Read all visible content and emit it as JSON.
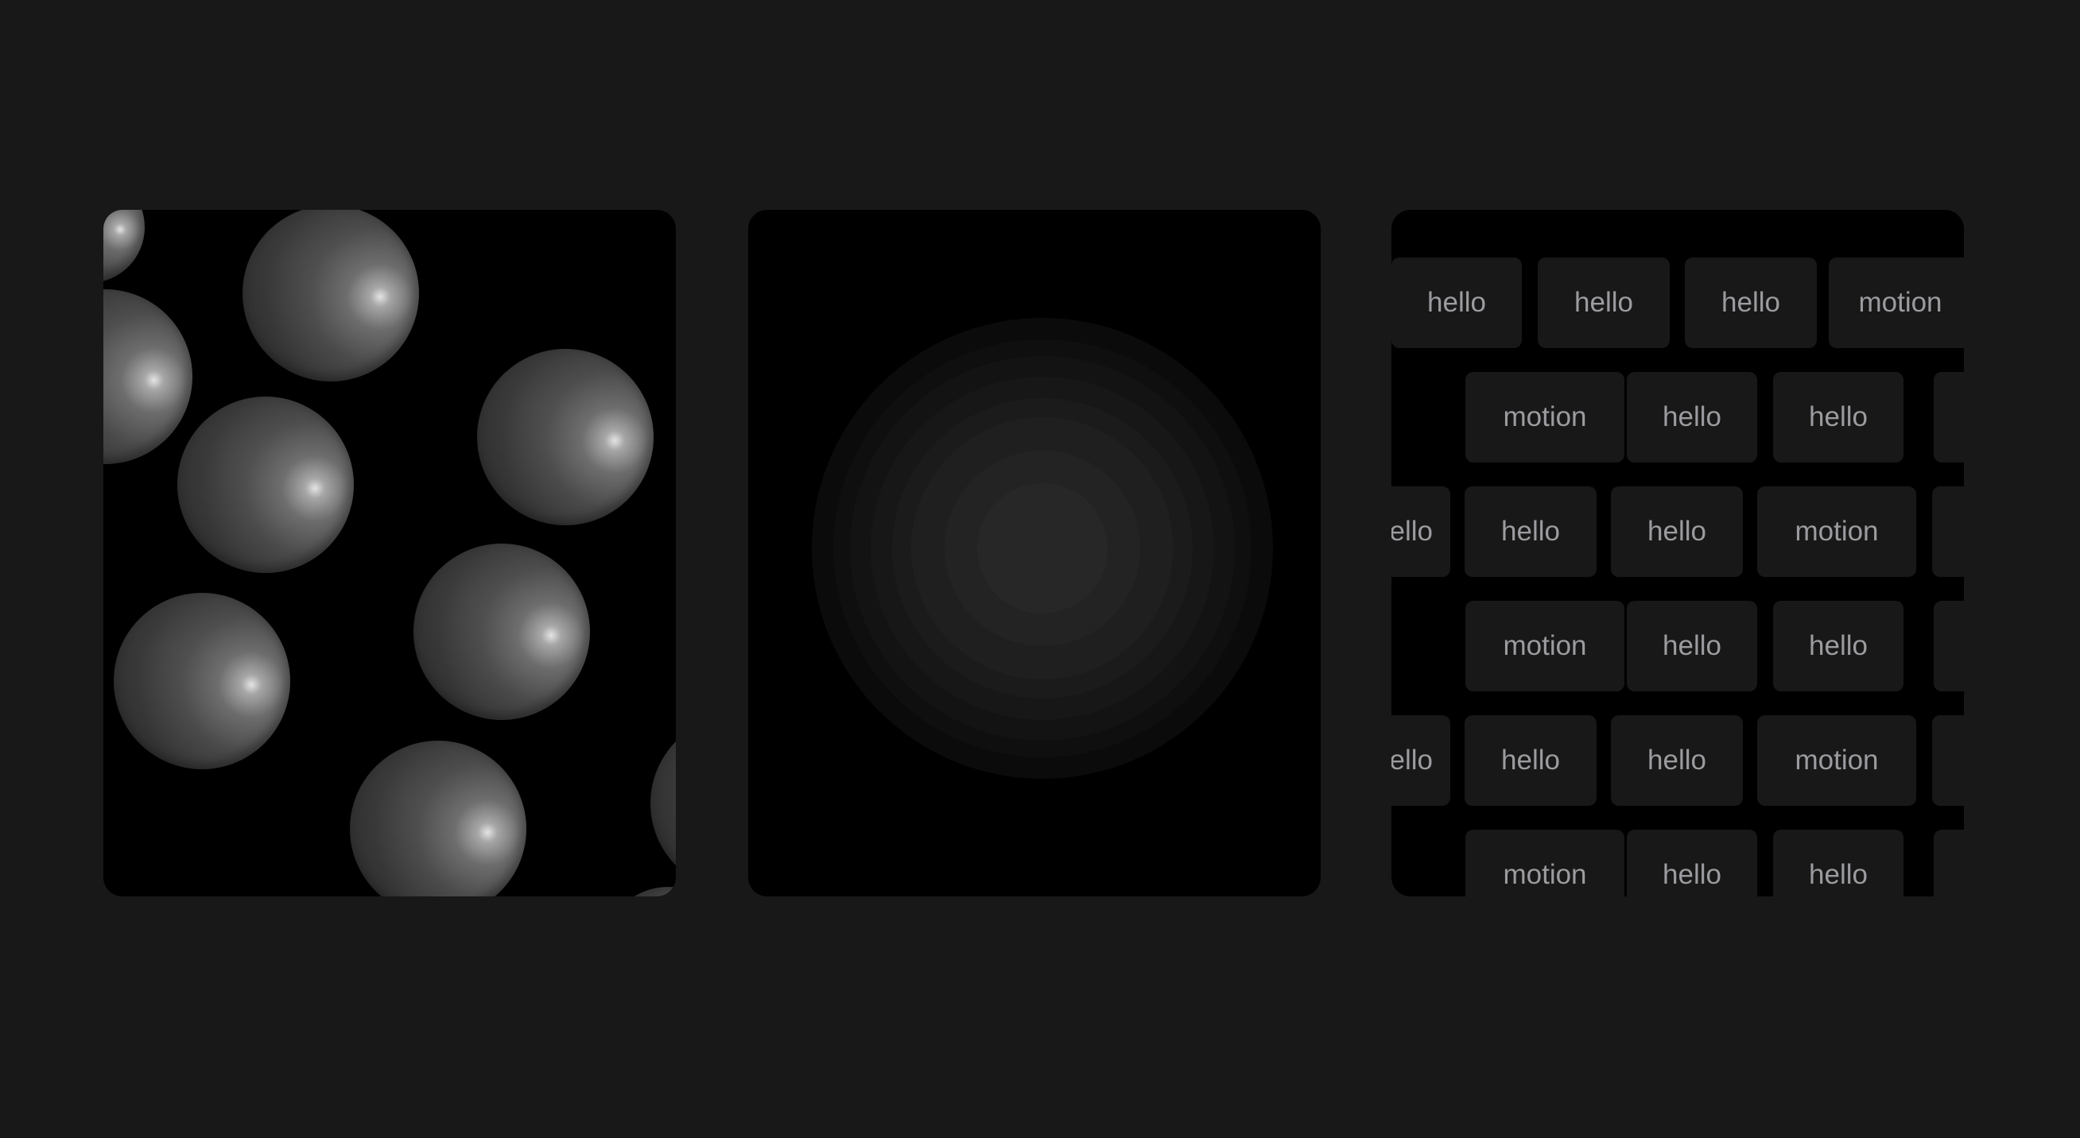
{
  "panels": {
    "spheres": {
      "sphere_count": 10
    },
    "rings": {
      "ring_count": 7
    },
    "tags": {
      "rows": [
        [
          "hello",
          "hello",
          "hello",
          "motion"
        ],
        [
          "motion",
          "hello",
          "hello",
          ""
        ],
        [
          "hello",
          "hello",
          "hello",
          "motion",
          ""
        ],
        [
          "motion",
          "hello",
          "hello",
          ""
        ],
        [
          "hello",
          "hello",
          "hello",
          "motion",
          ""
        ],
        [
          "motion",
          "hello",
          "hello",
          ""
        ]
      ]
    }
  },
  "colors": {
    "background": "#181818",
    "panel": "#000000",
    "tag_background": "#181818",
    "tag_text": "#9c9ca0"
  }
}
